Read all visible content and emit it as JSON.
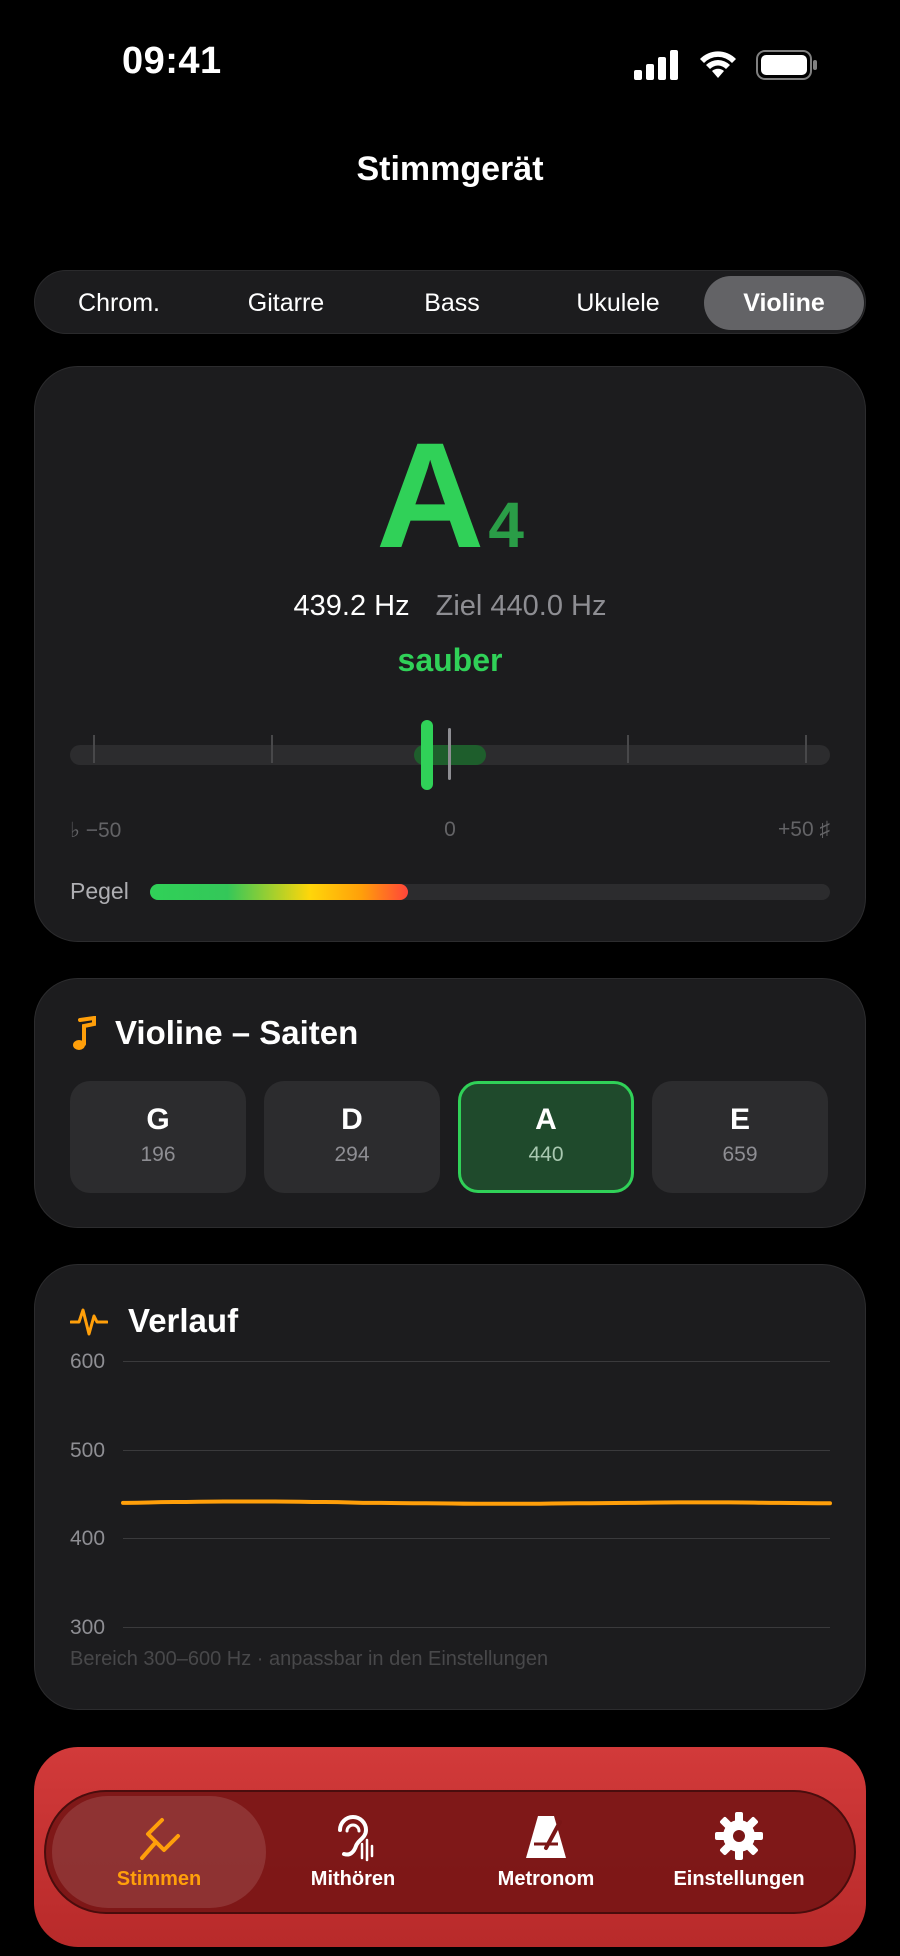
{
  "status": {
    "time": "09:41"
  },
  "header": {
    "title": "Stimmgerät"
  },
  "segments": [
    {
      "label": "Chrom.",
      "active": false
    },
    {
      "label": "Gitarre",
      "active": false
    },
    {
      "label": "Bass",
      "active": false
    },
    {
      "label": "Ukulele",
      "active": false
    },
    {
      "label": "Violine",
      "active": true
    }
  ],
  "tuner": {
    "note": "A",
    "octave": "4",
    "current_freq": "439.2 Hz",
    "target_freq": "Ziel 440.0 Hz",
    "state": "sauber",
    "scale_left": "♭ −50",
    "scale_center": "0",
    "scale_right": "+50 ♯",
    "cents_deviation": -3,
    "level_label": "Pegel",
    "level_fraction": 0.38,
    "accent_color": "#30d158"
  },
  "strings": {
    "title": "Violine – Saiten",
    "items": [
      {
        "note": "G",
        "freq": "196",
        "active": false
      },
      {
        "note": "D",
        "freq": "294",
        "active": false
      },
      {
        "note": "A",
        "freq": "440",
        "active": true
      },
      {
        "note": "E",
        "freq": "659",
        "active": false
      }
    ]
  },
  "history": {
    "title": "Verlauf",
    "footnote": "Bereich 300–600 Hz · anpassbar in den Einstellungen",
    "line_color": "#ff9f0a"
  },
  "chart_data": {
    "type": "line",
    "title": "Verlauf",
    "ylim": [
      300,
      600
    ],
    "yticks": [
      "600",
      "500",
      "400",
      "300"
    ],
    "grid": true,
    "series": [
      {
        "values": [
          440,
          441,
          441.5,
          441.5,
          441,
          440,
          439.5,
          439,
          439,
          439.5,
          440,
          440.5,
          440.5,
          440,
          439.5
        ]
      }
    ]
  },
  "tabbar": [
    {
      "label": "Stimmen",
      "icon": "tuning-fork-icon",
      "active": true
    },
    {
      "label": "Mithören",
      "icon": "ear-icon",
      "active": false
    },
    {
      "label": "Metronom",
      "icon": "metronome-icon",
      "active": false
    },
    {
      "label": "Einstellungen",
      "icon": "gear-icon",
      "active": false
    }
  ]
}
